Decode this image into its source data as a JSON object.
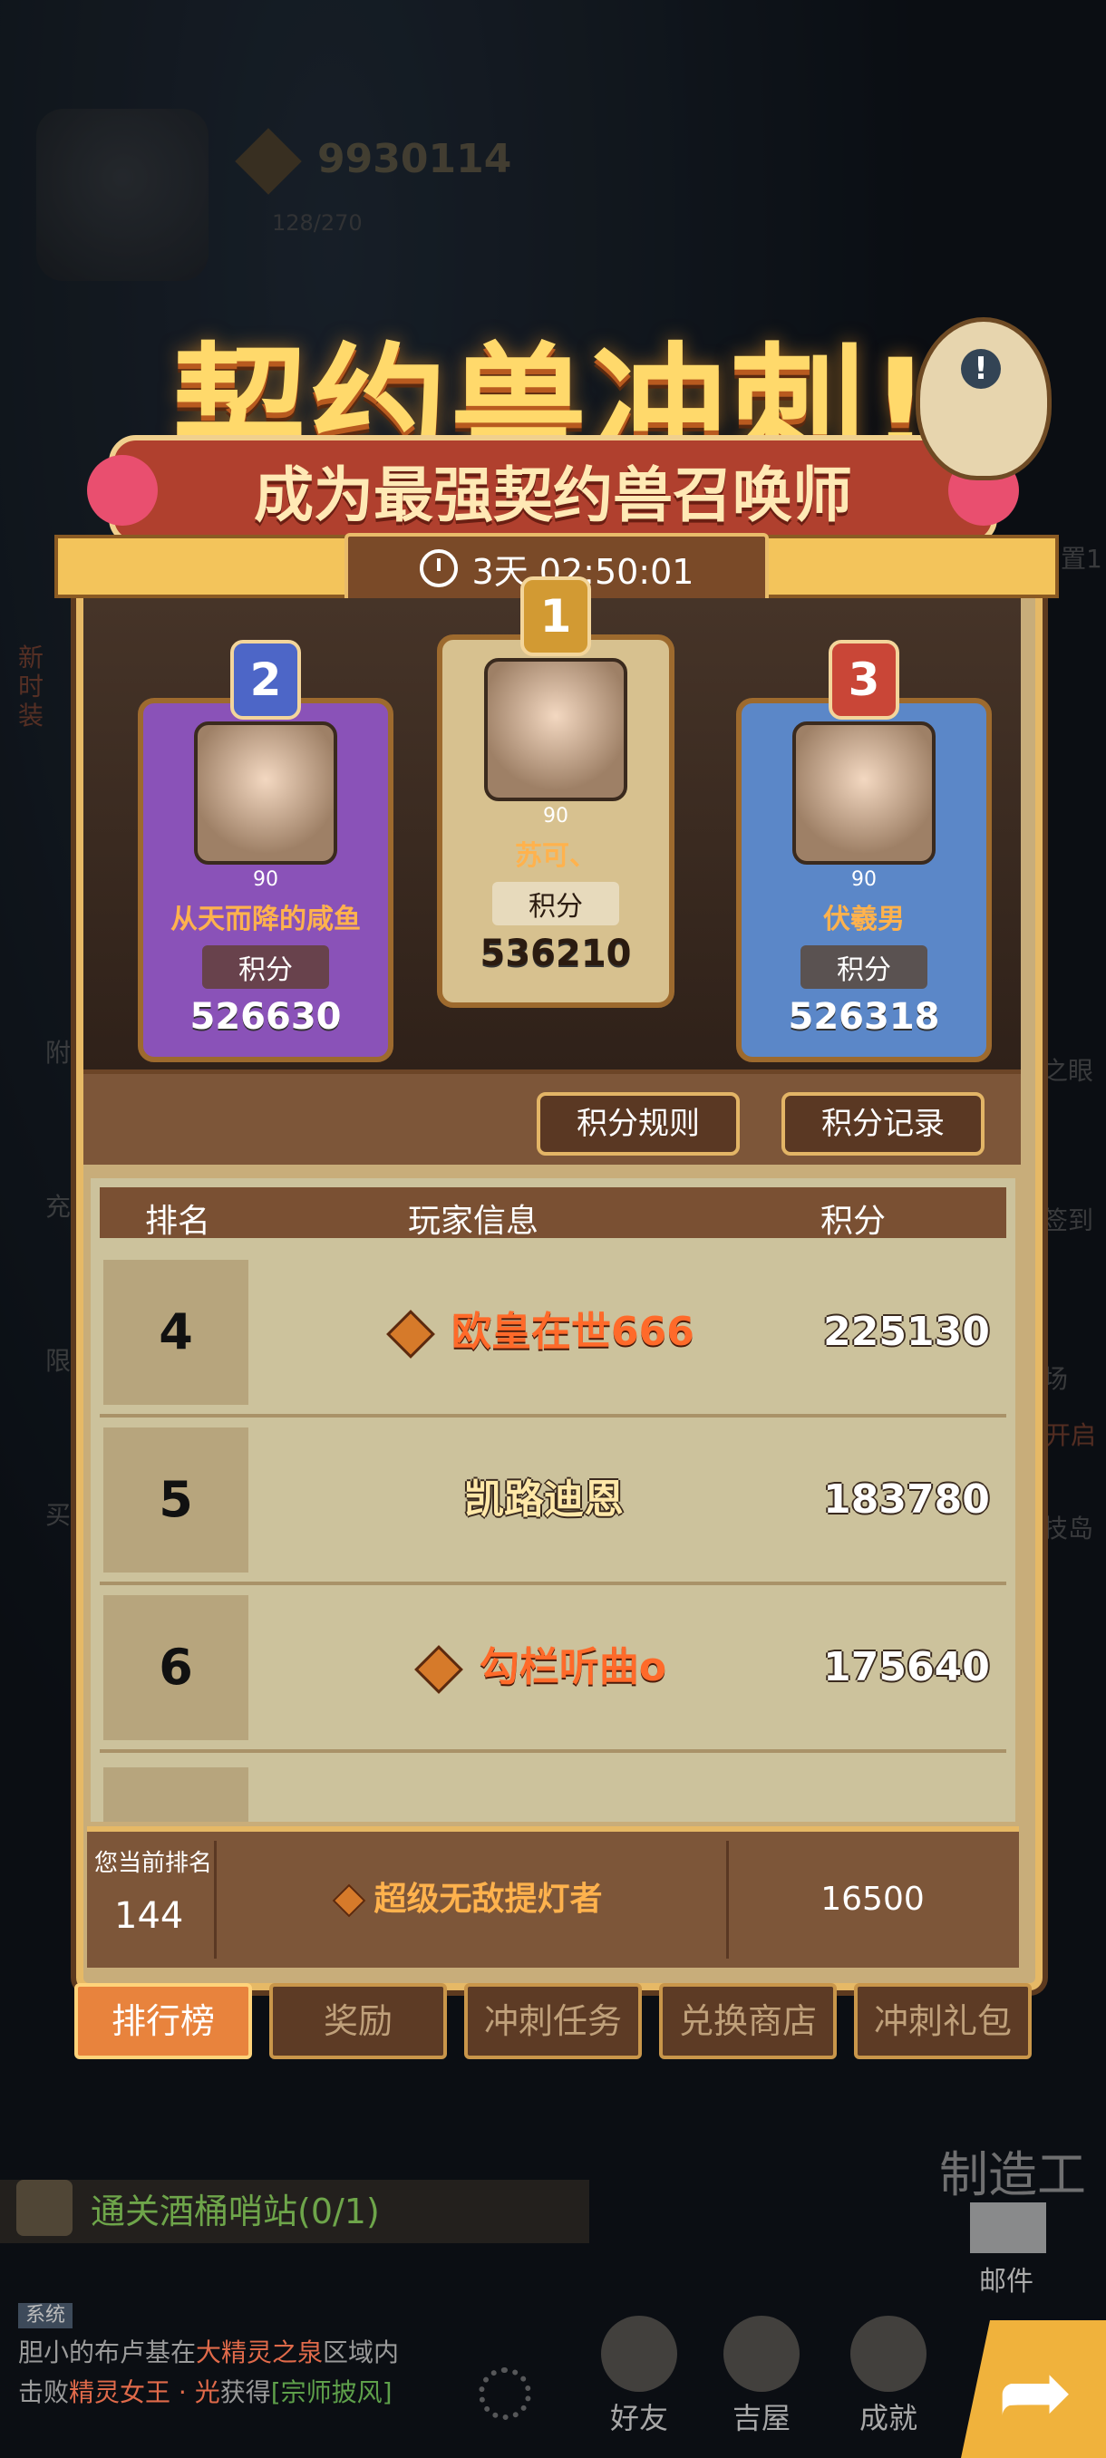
{
  "hud": {
    "resource": "9930114",
    "energy": "128/270"
  },
  "side_labels": [
    "新时装",
    "附",
    "充",
    "限",
    "买",
    "之眼",
    "签到",
    "场",
    "将开启",
    "技岛",
    "置1"
  ],
  "banner": {
    "title": "契约兽冲刺!",
    "subtitle": "成为最强契约兽召唤师"
  },
  "timer": "3天 02:50:01",
  "podium": [
    {
      "rank": "2",
      "level": "90",
      "name": "从天而降的咸鱼",
      "label": "积分",
      "score": "526630"
    },
    {
      "rank": "1",
      "level": "90",
      "name": "苏可、",
      "label": "积分",
      "score": "536210"
    },
    {
      "rank": "3",
      "level": "90",
      "name": "伏羲男",
      "label": "积分",
      "score": "526318"
    }
  ],
  "buttons": {
    "rules": "积分规则",
    "records": "积分记录"
  },
  "table": {
    "headers": {
      "rank": "排名",
      "player": "玩家信息",
      "score": "积分"
    },
    "rows": [
      {
        "rank": "4",
        "name": "欧皇在世666",
        "score": "225130"
      },
      {
        "rank": "5",
        "name": "凯路迪恩",
        "score": "183780"
      },
      {
        "rank": "6",
        "name": "勾栏听曲o",
        "score": "175640"
      }
    ]
  },
  "my_rank": {
    "label": "您当前排名",
    "rank": "144",
    "name": "超级无敌提灯者",
    "score": "16500"
  },
  "tabs": [
    "排行榜",
    "奖励",
    "冲刺任务",
    "兑换商店",
    "冲刺礼包"
  ],
  "quest": "通关酒桶哨站(0/1)",
  "chat": {
    "tag": "系统",
    "line1_a": "胆小的布卢基在",
    "line1_b": "大精灵之泉",
    "line1_c": "区域内",
    "line2_a": "击败",
    "line2_b": "精灵女王 · 光",
    "line2_c": "获得",
    "line2_d": "[宗师披风]"
  },
  "nav": {
    "friends": "好友",
    "house": "吉屋",
    "achievement": "成就",
    "mail": "邮件",
    "craft": "制造工"
  }
}
